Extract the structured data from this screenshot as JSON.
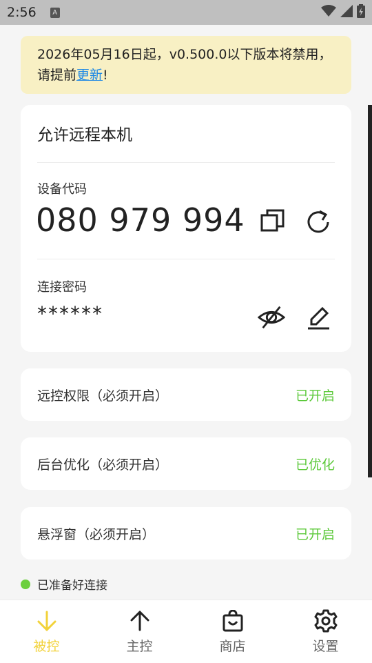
{
  "status_bar": {
    "time": "2:56",
    "notification_icon": "a-icon",
    "wifi_icon": "wifi-icon",
    "signal_icon": "signal-icon",
    "battery_icon": "battery-icon"
  },
  "banner": {
    "text_before_link": "2026年05月16日起，v0.500.0以下版本将禁用，请提前",
    "link_text": "更新",
    "text_after_link": "!"
  },
  "main_card": {
    "title": "允许远程本机",
    "device_code_label": "设备代码",
    "device_code": "080 979 994",
    "password_label": "连接密码",
    "password_mask": "******"
  },
  "permissions": [
    {
      "label": "远控权限（必须开启）",
      "status": "已开启"
    },
    {
      "label": "后台优化（必须开启）",
      "status": "已优化"
    },
    {
      "label": "悬浮窗（必须开启）",
      "status": "已开启"
    }
  ],
  "ready_status": "已准备好连接",
  "bottom_nav": [
    {
      "label": "被控",
      "icon": "arrow-down-icon",
      "active": true
    },
    {
      "label": "主控",
      "icon": "arrow-up-icon",
      "active": false
    },
    {
      "label": "商店",
      "icon": "shopping-bag-icon",
      "active": false
    },
    {
      "label": "设置",
      "icon": "gear-icon",
      "active": false
    }
  ],
  "colors": {
    "accent": "#f2d23a",
    "success": "#5cc93a",
    "banner_bg": "#f8f0c4",
    "link": "#1e88e5"
  }
}
